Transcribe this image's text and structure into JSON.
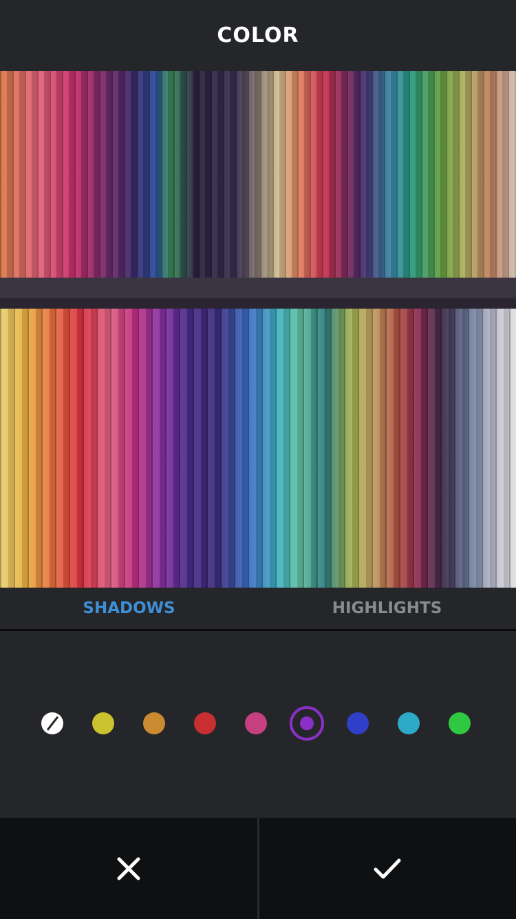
{
  "header": {
    "title": "COLOR"
  },
  "photo": {
    "description_icon": "image-preview"
  },
  "tabs": [
    {
      "label": "SHADOWS",
      "active": true
    },
    {
      "label": "HIGHLIGHTS",
      "active": false
    }
  ],
  "swatches": [
    {
      "name": "none",
      "color": "#ffffff"
    },
    {
      "name": "yellow",
      "color": "#cbc22f"
    },
    {
      "name": "orange",
      "color": "#c98a30"
    },
    {
      "name": "red",
      "color": "#c82f30"
    },
    {
      "name": "pink",
      "color": "#c4407f"
    },
    {
      "name": "purple",
      "color": "#8a30c8",
      "selected": true
    },
    {
      "name": "blue",
      "color": "#2f3fc8"
    },
    {
      "name": "cyan",
      "color": "#2daac8"
    },
    {
      "name": "green",
      "color": "#2fc840"
    }
  ],
  "actions": {
    "cancel_icon": "close-icon",
    "confirm_icon": "check-icon"
  }
}
